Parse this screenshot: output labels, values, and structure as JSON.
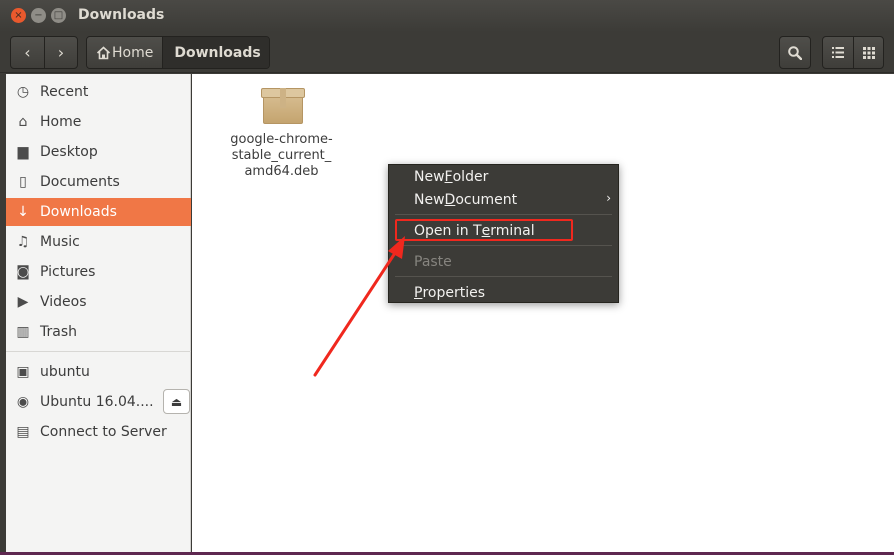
{
  "window": {
    "title": "Downloads",
    "close_glyph": "×",
    "min_glyph": "−",
    "max_glyph": "□"
  },
  "toolbar": {
    "back_icon": "‹",
    "forward_icon": "›",
    "crumbs": [
      {
        "label": "Home",
        "icon": "home-icon"
      },
      {
        "label": "Downloads"
      }
    ],
    "search_icon": "search-icon",
    "list_icon": "list-view-icon",
    "grid_icon": "grid-view-icon"
  },
  "sidebar": {
    "items": [
      {
        "label": "Recent",
        "icon": "recent-icon"
      },
      {
        "label": "Home",
        "icon": "home-icon"
      },
      {
        "label": "Desktop",
        "icon": "desktop-icon"
      },
      {
        "label": "Documents",
        "icon": "documents-icon"
      },
      {
        "label": "Downloads",
        "icon": "downloads-icon"
      },
      {
        "label": "Music",
        "icon": "music-icon"
      },
      {
        "label": "Pictures",
        "icon": "pictures-icon"
      },
      {
        "label": "Videos",
        "icon": "videos-icon"
      },
      {
        "label": "Trash",
        "icon": "trash-icon"
      }
    ],
    "devices": [
      {
        "label": "ubuntu",
        "icon": "drive-icon"
      },
      {
        "label": "Ubuntu 16.04....",
        "icon": "disc-icon"
      },
      {
        "label": "Connect to Server",
        "icon": "server-icon"
      }
    ],
    "selected": "Downloads"
  },
  "files": [
    {
      "name": "google-chrome-stable_current_amd64.deb",
      "line1": "google-chrome-",
      "line2": "stable_current_",
      "line3": "amd64.deb",
      "icon": "package-icon"
    }
  ],
  "context_menu": {
    "items": [
      {
        "label": "New Folder",
        "pre": "New ",
        "ul": "F",
        "post": "older"
      },
      {
        "label": "New Document",
        "pre": "New ",
        "ul": "D",
        "post": "ocument",
        "submenu": "›"
      },
      {
        "label": "Open in Terminal",
        "pre": "Open in T",
        "ul": "e",
        "post": "rminal"
      },
      {
        "label": "Paste",
        "pre": "Paste",
        "ul": "",
        "post": ""
      },
      {
        "label": "Properties",
        "pre": "",
        "ul": "P",
        "post": "roperties"
      }
    ],
    "highlighted": "Open in Terminal",
    "disabled": "Paste"
  },
  "colors": {
    "accent": "#f07746",
    "annotation": "#f0281e",
    "chrome": "#3c3b37"
  }
}
